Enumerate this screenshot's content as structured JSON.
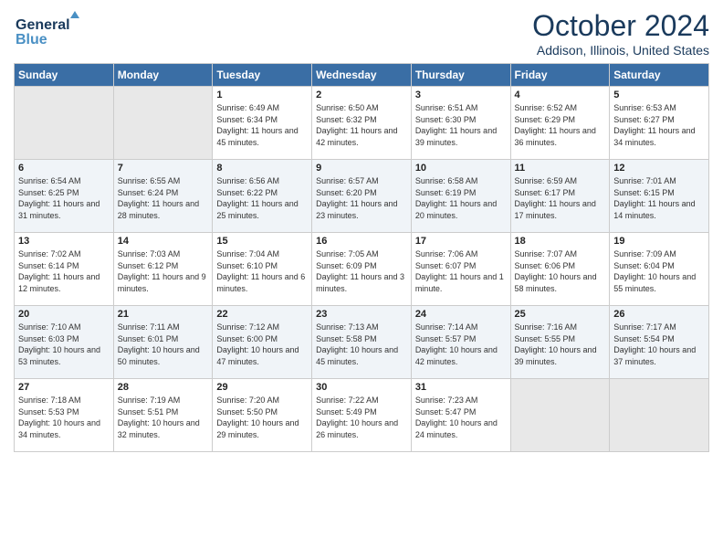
{
  "header": {
    "logo_line1": "General",
    "logo_line2": "Blue",
    "month": "October 2024",
    "location": "Addison, Illinois, United States"
  },
  "days_of_week": [
    "Sunday",
    "Monday",
    "Tuesday",
    "Wednesday",
    "Thursday",
    "Friday",
    "Saturday"
  ],
  "weeks": [
    [
      {
        "num": "",
        "info": ""
      },
      {
        "num": "",
        "info": ""
      },
      {
        "num": "1",
        "info": "Sunrise: 6:49 AM\nSunset: 6:34 PM\nDaylight: 11 hours and 45 minutes."
      },
      {
        "num": "2",
        "info": "Sunrise: 6:50 AM\nSunset: 6:32 PM\nDaylight: 11 hours and 42 minutes."
      },
      {
        "num": "3",
        "info": "Sunrise: 6:51 AM\nSunset: 6:30 PM\nDaylight: 11 hours and 39 minutes."
      },
      {
        "num": "4",
        "info": "Sunrise: 6:52 AM\nSunset: 6:29 PM\nDaylight: 11 hours and 36 minutes."
      },
      {
        "num": "5",
        "info": "Sunrise: 6:53 AM\nSunset: 6:27 PM\nDaylight: 11 hours and 34 minutes."
      }
    ],
    [
      {
        "num": "6",
        "info": "Sunrise: 6:54 AM\nSunset: 6:25 PM\nDaylight: 11 hours and 31 minutes."
      },
      {
        "num": "7",
        "info": "Sunrise: 6:55 AM\nSunset: 6:24 PM\nDaylight: 11 hours and 28 minutes."
      },
      {
        "num": "8",
        "info": "Sunrise: 6:56 AM\nSunset: 6:22 PM\nDaylight: 11 hours and 25 minutes."
      },
      {
        "num": "9",
        "info": "Sunrise: 6:57 AM\nSunset: 6:20 PM\nDaylight: 11 hours and 23 minutes."
      },
      {
        "num": "10",
        "info": "Sunrise: 6:58 AM\nSunset: 6:19 PM\nDaylight: 11 hours and 20 minutes."
      },
      {
        "num": "11",
        "info": "Sunrise: 6:59 AM\nSunset: 6:17 PM\nDaylight: 11 hours and 17 minutes."
      },
      {
        "num": "12",
        "info": "Sunrise: 7:01 AM\nSunset: 6:15 PM\nDaylight: 11 hours and 14 minutes."
      }
    ],
    [
      {
        "num": "13",
        "info": "Sunrise: 7:02 AM\nSunset: 6:14 PM\nDaylight: 11 hours and 12 minutes."
      },
      {
        "num": "14",
        "info": "Sunrise: 7:03 AM\nSunset: 6:12 PM\nDaylight: 11 hours and 9 minutes."
      },
      {
        "num": "15",
        "info": "Sunrise: 7:04 AM\nSunset: 6:10 PM\nDaylight: 11 hours and 6 minutes."
      },
      {
        "num": "16",
        "info": "Sunrise: 7:05 AM\nSunset: 6:09 PM\nDaylight: 11 hours and 3 minutes."
      },
      {
        "num": "17",
        "info": "Sunrise: 7:06 AM\nSunset: 6:07 PM\nDaylight: 11 hours and 1 minute."
      },
      {
        "num": "18",
        "info": "Sunrise: 7:07 AM\nSunset: 6:06 PM\nDaylight: 10 hours and 58 minutes."
      },
      {
        "num": "19",
        "info": "Sunrise: 7:09 AM\nSunset: 6:04 PM\nDaylight: 10 hours and 55 minutes."
      }
    ],
    [
      {
        "num": "20",
        "info": "Sunrise: 7:10 AM\nSunset: 6:03 PM\nDaylight: 10 hours and 53 minutes."
      },
      {
        "num": "21",
        "info": "Sunrise: 7:11 AM\nSunset: 6:01 PM\nDaylight: 10 hours and 50 minutes."
      },
      {
        "num": "22",
        "info": "Sunrise: 7:12 AM\nSunset: 6:00 PM\nDaylight: 10 hours and 47 minutes."
      },
      {
        "num": "23",
        "info": "Sunrise: 7:13 AM\nSunset: 5:58 PM\nDaylight: 10 hours and 45 minutes."
      },
      {
        "num": "24",
        "info": "Sunrise: 7:14 AM\nSunset: 5:57 PM\nDaylight: 10 hours and 42 minutes."
      },
      {
        "num": "25",
        "info": "Sunrise: 7:16 AM\nSunset: 5:55 PM\nDaylight: 10 hours and 39 minutes."
      },
      {
        "num": "26",
        "info": "Sunrise: 7:17 AM\nSunset: 5:54 PM\nDaylight: 10 hours and 37 minutes."
      }
    ],
    [
      {
        "num": "27",
        "info": "Sunrise: 7:18 AM\nSunset: 5:53 PM\nDaylight: 10 hours and 34 minutes."
      },
      {
        "num": "28",
        "info": "Sunrise: 7:19 AM\nSunset: 5:51 PM\nDaylight: 10 hours and 32 minutes."
      },
      {
        "num": "29",
        "info": "Sunrise: 7:20 AM\nSunset: 5:50 PM\nDaylight: 10 hours and 29 minutes."
      },
      {
        "num": "30",
        "info": "Sunrise: 7:22 AM\nSunset: 5:49 PM\nDaylight: 10 hours and 26 minutes."
      },
      {
        "num": "31",
        "info": "Sunrise: 7:23 AM\nSunset: 5:47 PM\nDaylight: 10 hours and 24 minutes."
      },
      {
        "num": "",
        "info": ""
      },
      {
        "num": "",
        "info": ""
      }
    ]
  ]
}
